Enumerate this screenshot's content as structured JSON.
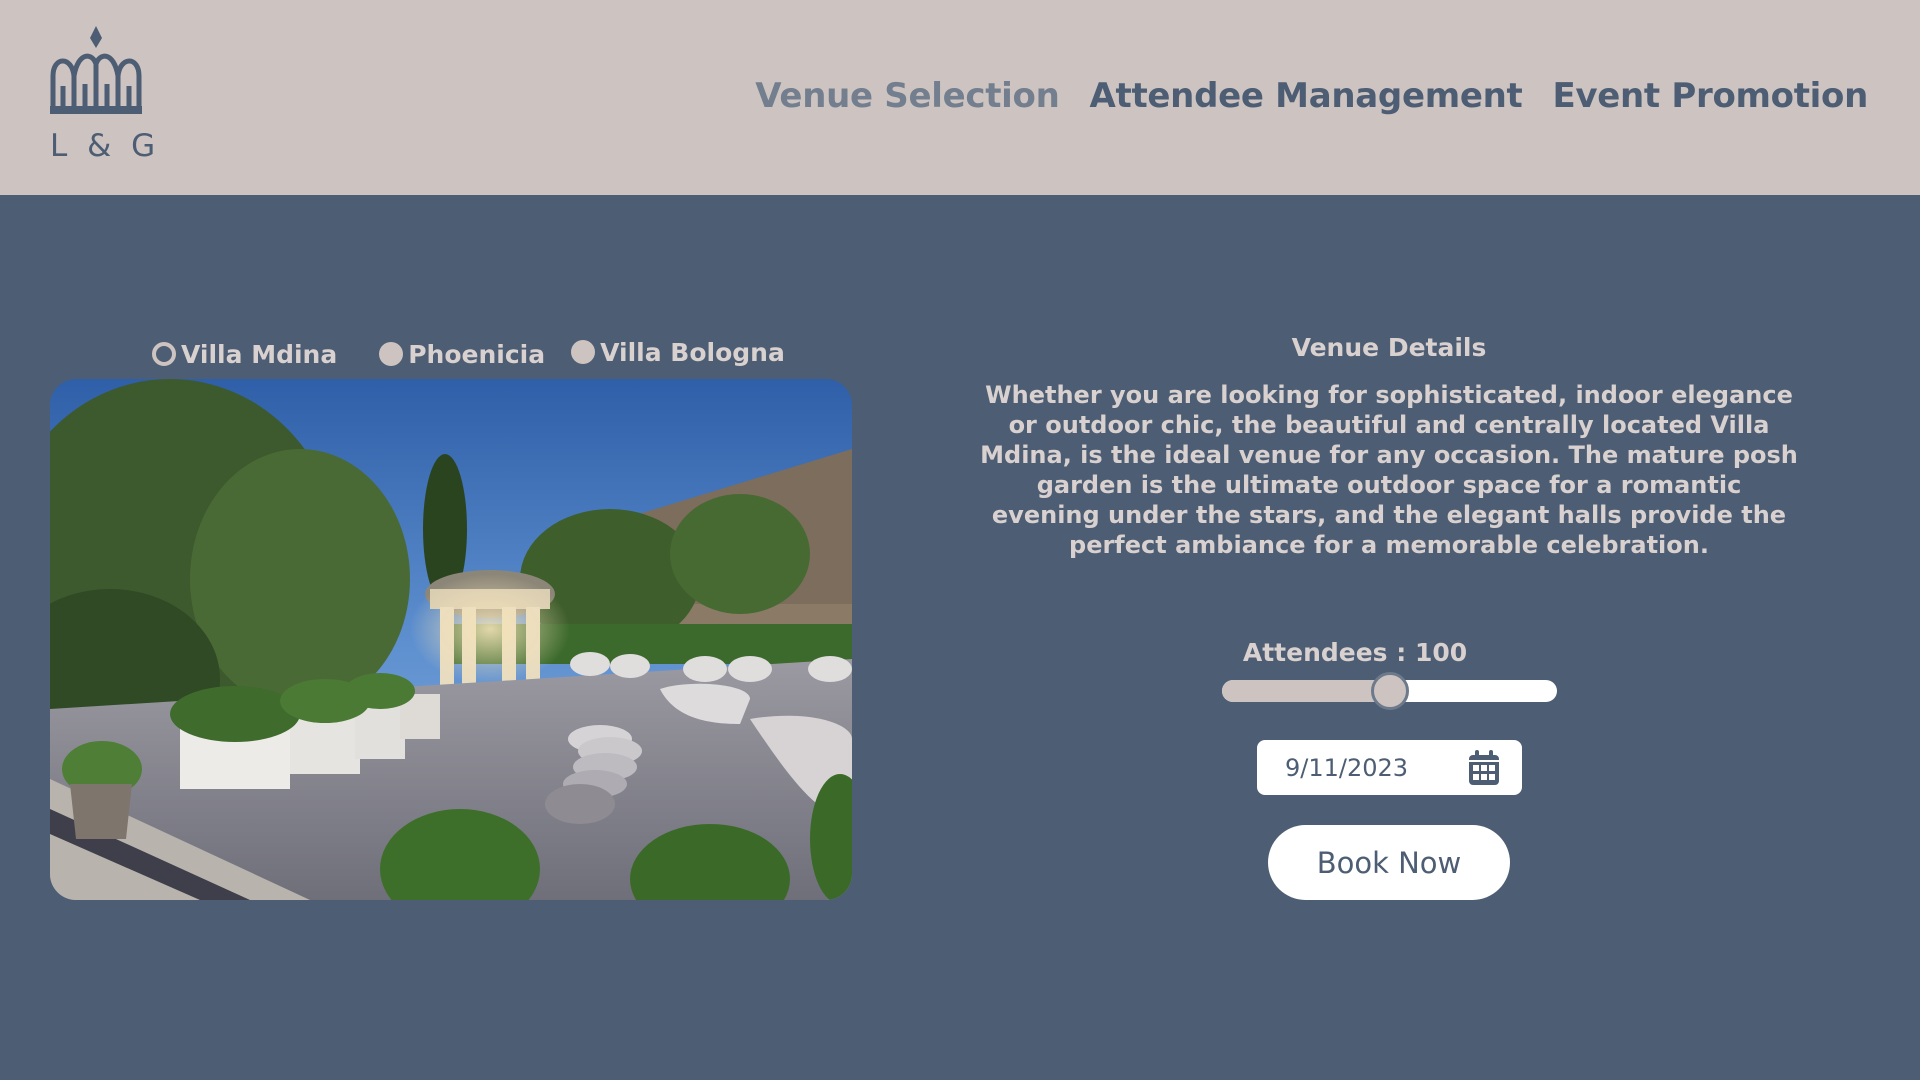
{
  "brand": {
    "logo_icon": "crown-icon",
    "logo_text": "L & G"
  },
  "nav": {
    "items": [
      {
        "label": "Venue Selection",
        "active": true
      },
      {
        "label": "Attendee Management",
        "active": false
      },
      {
        "label": "Event Promotion",
        "active": false
      }
    ]
  },
  "venues": {
    "options": [
      {
        "label": "Villa Mdina",
        "selected": true
      },
      {
        "label": "Phoenicia",
        "selected": false
      },
      {
        "label": "Villa Bologna",
        "selected": false
      }
    ]
  },
  "details": {
    "title": "Venue Details",
    "text": "Whether you are looking for sophisticated, indoor elegance or outdoor chic, the beautiful and centrally located Villa Mdina, is the ideal venue for any occasion. The mature posh garden is the ultimate outdoor space for a romantic evening under the stars, and the elegant halls provide the perfect ambiance for a memorable celebration."
  },
  "attendees": {
    "label": "Attendees : 100",
    "level_fraction": 0.5
  },
  "booking": {
    "date": "9/11/2023",
    "calendar_icon": "calendar-icon",
    "button_label": "Book Now"
  },
  "colors": {
    "page_background": "#4d5d73",
    "header_background": "#cdc4c1",
    "accent": "#4d5d73",
    "light_text": "#d8d1cf",
    "active_nav": "#737f8e"
  }
}
